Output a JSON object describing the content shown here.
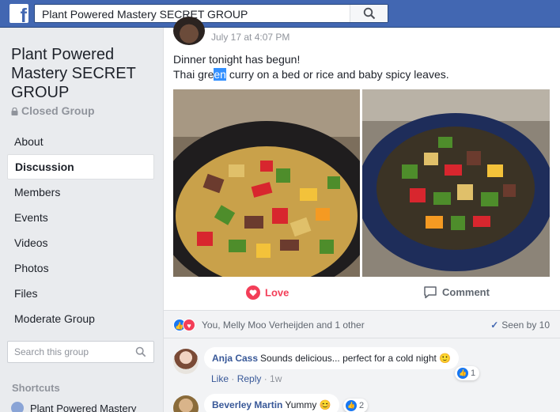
{
  "topbar": {
    "logo": "f",
    "search_query": "Plant Powered Mastery SECRET GROUP"
  },
  "sidebar": {
    "group_title": "Plant Powered Mastery SECRET GROUP",
    "privacy": "Closed Group",
    "nav": [
      {
        "label": "About"
      },
      {
        "label": "Discussion"
      },
      {
        "label": "Members"
      },
      {
        "label": "Events"
      },
      {
        "label": "Videos"
      },
      {
        "label": "Photos"
      },
      {
        "label": "Files"
      },
      {
        "label": "Moderate Group"
      }
    ],
    "active_nav": "Discussion",
    "search_placeholder": "Search this group",
    "shortcuts_heading": "Shortcuts",
    "shortcut_item": "Plant Powered Mastery"
  },
  "post": {
    "time": "July 17 at 4:07 PM",
    "line1": "Dinner tonight has begun!",
    "line2_pre": "Thai gre",
    "line2_sel": "en",
    "line2_post": " curry on a bed or rice and baby spicy leaves.",
    "love_label": "Love",
    "comment_label": "Comment",
    "reactions_text": "You, Melly Moo Verheijden and 1 other",
    "seen_text": "Seen by 10"
  },
  "comments": [
    {
      "author": "Anja Cass",
      "text": "Sounds delicious... perfect for a cold night 🙂",
      "like": "Like",
      "reply": "Reply",
      "age": "1w",
      "likes": "1"
    },
    {
      "author": "Beverley Martin",
      "text": "Yummy 😊",
      "likes": "2"
    }
  ],
  "colors": {
    "brand": "#4267b2",
    "love": "#f33e58",
    "link": "#385898"
  }
}
